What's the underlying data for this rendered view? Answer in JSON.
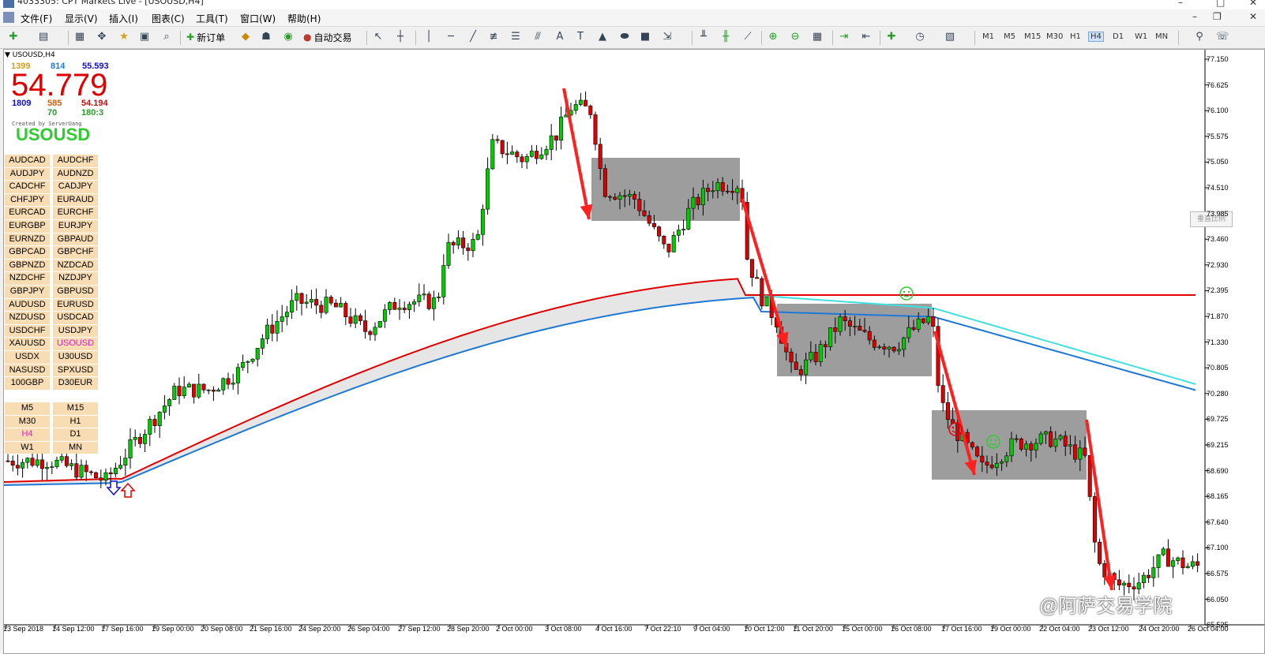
{
  "window": {
    "title": "4033305: CPT Markets Live - [USOUSD,H4]"
  },
  "menu": [
    "文件(F)",
    "显示(V)",
    "插入(I)",
    "图表(C)",
    "工具(T)",
    "窗口(W)",
    "帮助(H)"
  ],
  "toolbar": {
    "new_order": "新订单",
    "auto_trade": "自动交易",
    "timeframes": [
      "M1",
      "M5",
      "M15",
      "M30",
      "H1",
      "H4",
      "D1",
      "W1",
      "MN"
    ],
    "active_timeframe": "H4"
  },
  "chart": {
    "symbol_title": "USOUSD,H4",
    "price_big": "54.779",
    "stats_row1": [
      "1399",
      "814",
      "55.593"
    ],
    "stats_row2": [
      "1809",
      "585",
      "54.194"
    ],
    "stats_row3": [
      "70",
      "180:3"
    ],
    "created_by": "Created by ServerUang",
    "symbol_big": "USOUSD",
    "pairs": [
      "AUDCAD",
      "AUDCHF",
      "AUDJPY",
      "AUDNZD",
      "CADCHF",
      "CADJPY",
      "CHFJPY",
      "EURAUD",
      "EURCAD",
      "EURCHF",
      "EURGBP",
      "EURJPY",
      "EURNZD",
      "GBPAUD",
      "GBPCAD",
      "GBPCHF",
      "GBPNZD",
      "NZDCAD",
      "NZDCHF",
      "NZDJPY",
      "GBPJPY",
      "GBPUSD",
      "AUDUSD",
      "EURUSD",
      "NZDUSD",
      "USDCAD",
      "USDCHF",
      "USDJPY",
      "XAUUSD",
      "USOUSD",
      "USDX",
      "U30USD",
      "NASUSD",
      "SPXUSD",
      "100GBP",
      "D30EUR"
    ],
    "highlight_pair": "USOUSD",
    "timeframe_buttons": [
      "M5",
      "M15",
      "M30",
      "H1",
      "H4",
      "D1",
      "W1",
      "MN"
    ],
    "y_labels": [
      "77.150",
      "76.625",
      "76.100",
      "75.575",
      "75.050",
      "74.510",
      "73.985",
      "73.460",
      "72.930",
      "72.395",
      "71.870",
      "71.330",
      "70.805",
      "70.280",
      "69.725",
      "69.215",
      "68.690",
      "68.165",
      "67.640",
      "67.100",
      "66.575",
      "66.050",
      "65.525"
    ],
    "x_labels": [
      "13 Sep 2018",
      "14 Sep 12:00",
      "17 Sep 16:00",
      "19 Sep 00:00",
      "20 Sep 08:00",
      "21 Sep 16:00",
      "24 Sep 20:00",
      "26 Sep 04:00",
      "27 Sep 12:00",
      "28 Sep 20:00",
      "2 Oct 00:00",
      "3 Oct 08:00",
      "4 Oct 16:00",
      "7 Oct 22:10",
      "9 Oct 04:00",
      "10 Oct 12:00",
      "11 Oct 20:00",
      "15 Oct 00:00",
      "16 Oct 08:00",
      "17 Oct 16:00",
      "19 Oct 00:00",
      "22 Oct 04:00",
      "23 Oct 12:00",
      "24 Oct 20:00",
      "26 Oct 04:00"
    ],
    "side_button": "垂直比例",
    "watermark": "@阿萨交易学院"
  },
  "colors": {
    "bull": "#00cc00",
    "bear": "#e00000",
    "ma_red": "#e00000",
    "ma_blue": "#1e78d8",
    "ma_cyan": "#40e0e0",
    "box": "#8c8c8c",
    "arrow": "#ff2020"
  }
}
